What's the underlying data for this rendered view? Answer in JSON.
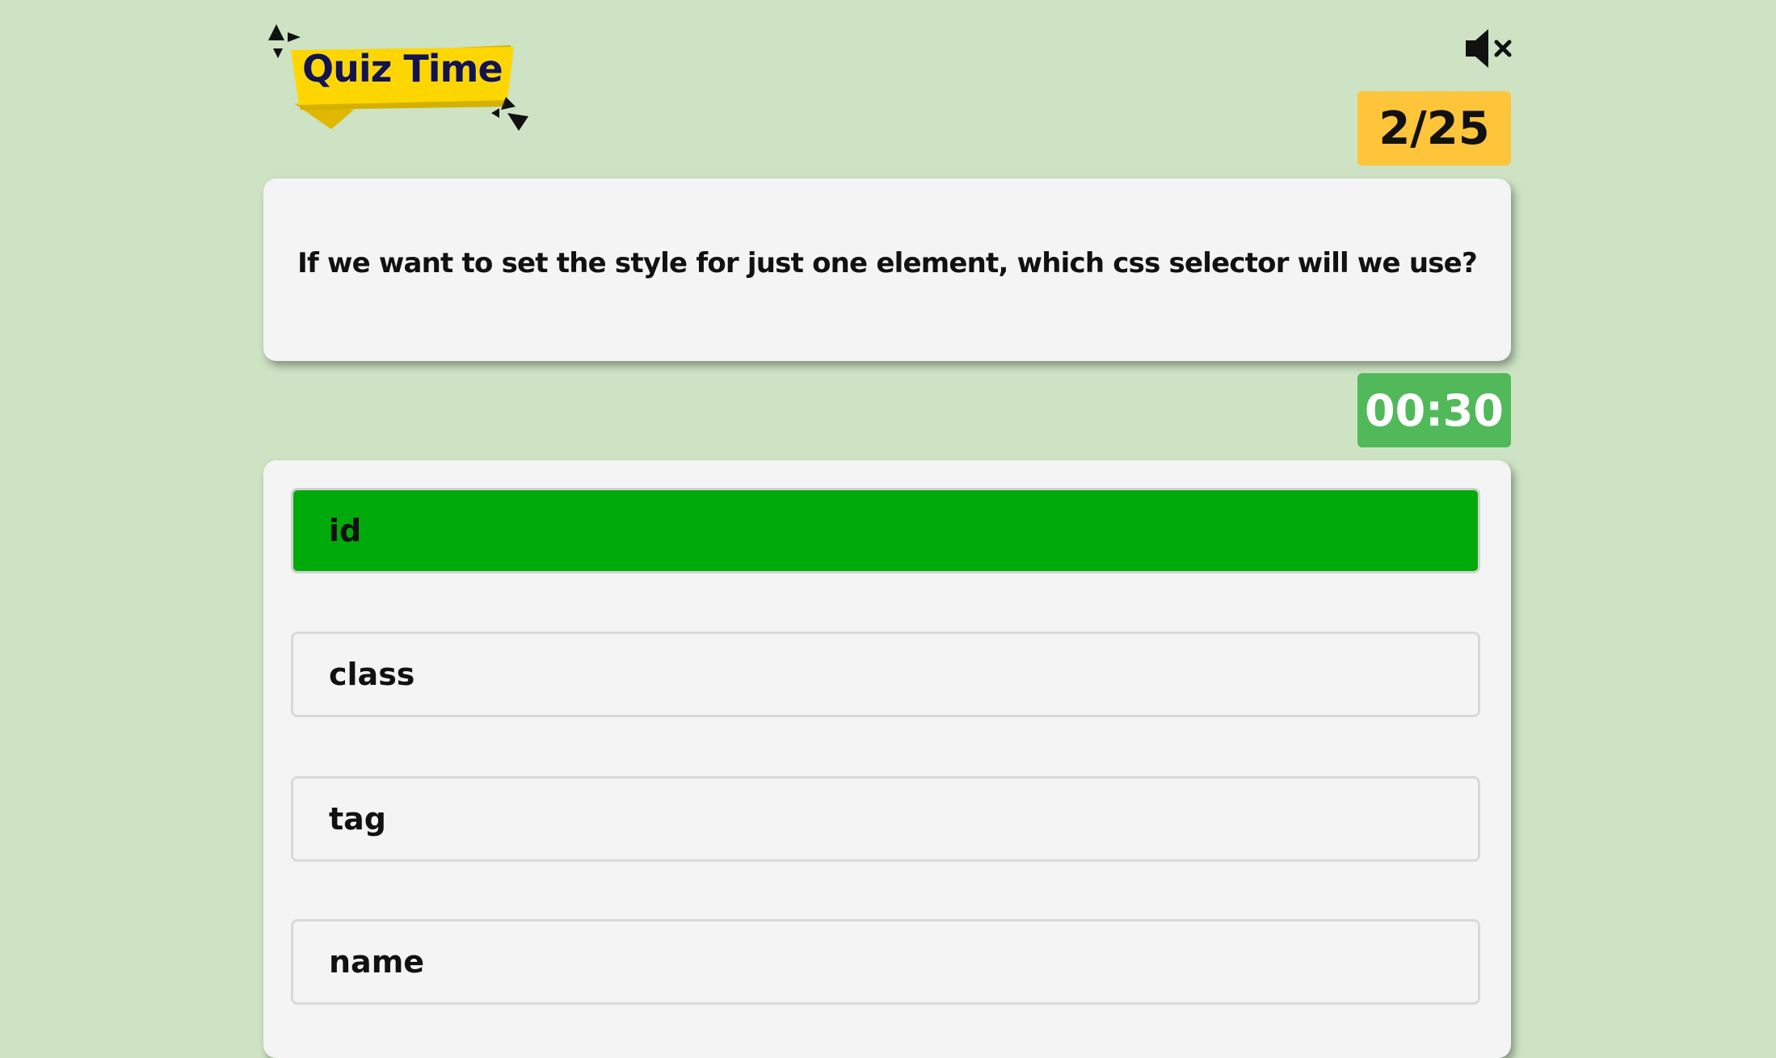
{
  "logo": {
    "text": "Quiz Time"
  },
  "sound": {
    "icon": "speaker-mute-icon"
  },
  "progress": {
    "current": 2,
    "total": 25,
    "label": "2/25"
  },
  "question": {
    "text": "If we want to set the style for just one element, which css selector will we use?"
  },
  "timer": {
    "value": "00:30"
  },
  "options": [
    {
      "label": "id",
      "selected": true
    },
    {
      "label": "class",
      "selected": false
    },
    {
      "label": "tag",
      "selected": false
    },
    {
      "label": "name",
      "selected": false
    }
  ],
  "colors": {
    "background": "#cde3c4",
    "counter": "#fec43a",
    "timer": "#52b95a",
    "selected_option": "#00aa0a",
    "logo_banner": "#fdd600",
    "logo_text": "#13144a"
  }
}
